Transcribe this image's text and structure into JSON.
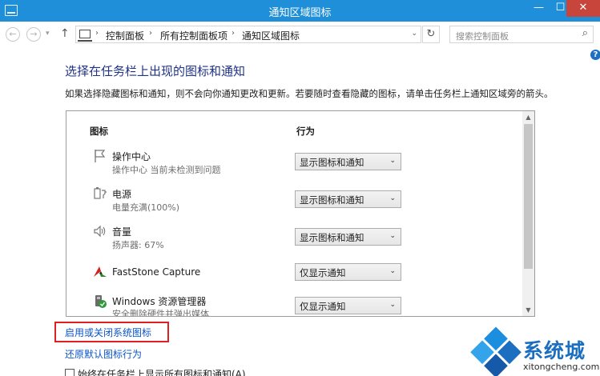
{
  "window": {
    "title": "通知区域图标",
    "min_glyph": "—",
    "max_glyph": "☐",
    "close_glyph": "✕"
  },
  "nav": {
    "back_glyph": "←",
    "forward_glyph": "→",
    "history_glyph": "▾",
    "up_glyph": "↑",
    "breadcrumb": [
      "控制面板",
      "所有控制面板项",
      "通知区域图标"
    ],
    "separator": "›",
    "address_dropdown_glyph": "⌄",
    "refresh_glyph": "↻",
    "search_placeholder": "搜索控制面板",
    "search_glyph": "⌕"
  },
  "help_glyph": "?",
  "main": {
    "title": "选择在任务栏上出现的图标和通知",
    "description": "如果选择隐藏图标和通知，则不会向你通知更改和更新。若要随时查看隐藏的图标，请单击任务栏上通知区域旁的箭头。",
    "table": {
      "col_icon": "图标",
      "col_behavior": "行为",
      "rows": [
        {
          "name": "操作中心",
          "subtitle": "操作中心  当前未检测到问题",
          "behavior": "显示图标和通知",
          "icon": "flag-icon"
        },
        {
          "name": "电源",
          "subtitle": "电量充满(100%)",
          "behavior": "显示图标和通知",
          "icon": "power-icon"
        },
        {
          "name": "音量",
          "subtitle": "扬声器: 67%",
          "behavior": "显示图标和通知",
          "icon": "speaker-icon"
        },
        {
          "name": "FastStone Capture",
          "subtitle": "",
          "behavior": "仅显示通知",
          "icon": "faststone-icon"
        },
        {
          "name": "Windows 资源管理器",
          "subtitle": "安全删除硬件并弹出媒体",
          "behavior": "仅显示通知",
          "icon": "usb-eject-icon"
        }
      ],
      "dropdown_glyph": "⌄",
      "scroll_up_glyph": "▲",
      "scroll_down_glyph": "▼"
    },
    "link_system_icons": "启用或关闭系统图标",
    "link_restore": "还原默认图标行为",
    "checkbox_label": "始终在任务栏上显示所有图标和通知(A)"
  },
  "watermark": {
    "brand": "系统城",
    "domain": "xitongcheng.com",
    "logo_colors": [
      "#1c8ee0",
      "#1c6fc0",
      "#34a4ea",
      "#1659a8"
    ]
  }
}
